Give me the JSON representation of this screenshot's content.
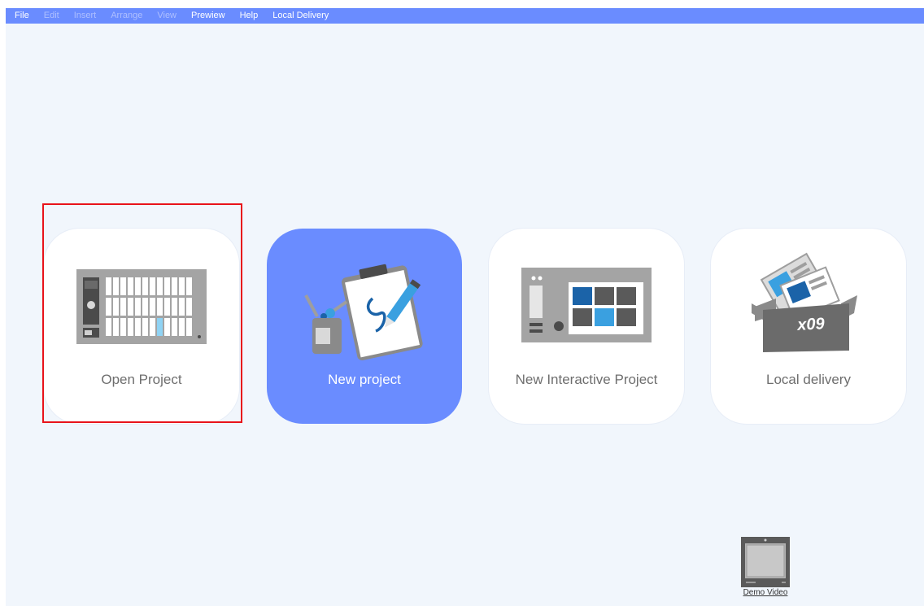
{
  "menubar": {
    "items": [
      {
        "label": "File",
        "enabled": true
      },
      {
        "label": "Edit",
        "enabled": false
      },
      {
        "label": "Insert",
        "enabled": false
      },
      {
        "label": "Arrange",
        "enabled": false
      },
      {
        "label": "View",
        "enabled": false
      },
      {
        "label": "Prewiew",
        "enabled": true
      },
      {
        "label": "Help",
        "enabled": true
      },
      {
        "label": "Local Delivery",
        "enabled": true
      }
    ]
  },
  "cards": {
    "open": {
      "label": "Open Project",
      "icon": "open-project-illustration"
    },
    "new": {
      "label": "New project",
      "icon": "new-project-illustration"
    },
    "interactive": {
      "label": "New Interactive Project",
      "icon": "interactive-project-illustration"
    },
    "local": {
      "label": "Local delivery",
      "icon": "local-delivery-box-illustration",
      "box_text": "x09"
    }
  },
  "demo": {
    "label": "Demo Video",
    "icon": "video-monitor-icon"
  },
  "colors": {
    "menubar": "#6a8cff",
    "background": "#f1f6fc",
    "primary_card": "#6a8cff",
    "highlight": "#e8131a"
  }
}
